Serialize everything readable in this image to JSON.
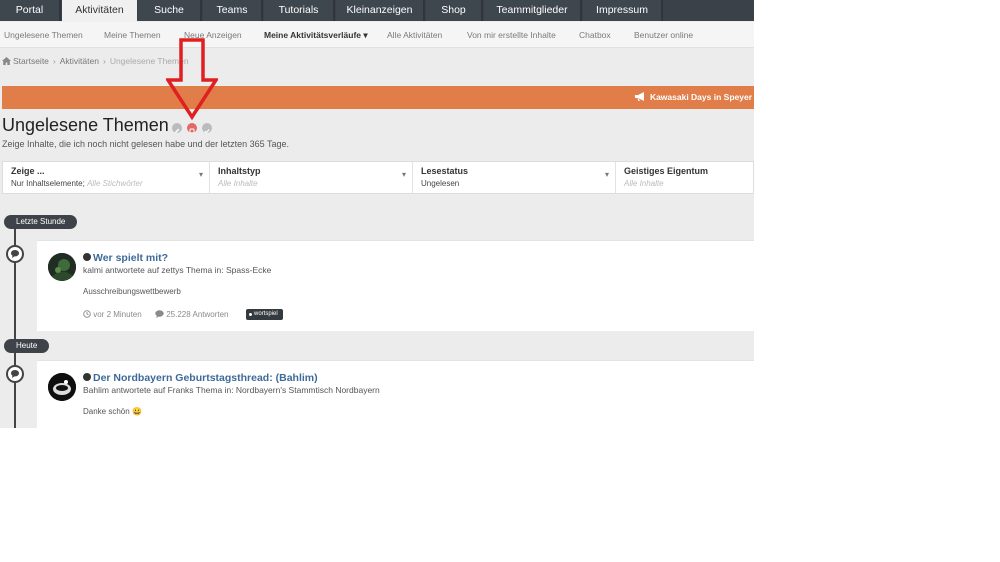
{
  "topnav": {
    "tabs": [
      {
        "label": "Portal"
      },
      {
        "label": "Aktivitäten"
      },
      {
        "label": "Suche"
      },
      {
        "label": "Teams"
      },
      {
        "label": "Tutorials"
      },
      {
        "label": "Kleinanzeigen"
      },
      {
        "label": "Shop"
      },
      {
        "label": "Teammitglieder"
      },
      {
        "label": "Impressum"
      }
    ],
    "active_tab": "Aktivitäten"
  },
  "subnav": {
    "items": [
      {
        "label": "Ungelesene Themen"
      },
      {
        "label": "Meine Themen"
      },
      {
        "label": "Neue Anzeigen"
      },
      {
        "label": "Meine Aktivitätsverläufe ▾"
      },
      {
        "label": "Alle Aktivitäten"
      },
      {
        "label": "Von mir erstellte Inhalte"
      },
      {
        "label": "Chatbox"
      },
      {
        "label": "Benutzer online"
      }
    ]
  },
  "breadcrumb": {
    "items": [
      {
        "label": "Startseite"
      },
      {
        "label": "Aktivitäten"
      },
      {
        "label": "Ungelesene Themen"
      }
    ]
  },
  "banner": {
    "text": "Kawasaki Days in Speyer",
    "color": "#e07d49"
  },
  "page": {
    "title": "Ungelesene Themen",
    "subtitle": "Zeige Inhalte, die ich noch nicht gelesen habe und der letzten 365 Tage."
  },
  "filters": [
    {
      "label": "Zeige ...",
      "value": "Nur Inhaltselemente;",
      "placeholder": "Alle Stichwörter"
    },
    {
      "label": "Inhaltstyp",
      "value": "",
      "placeholder": "Alle Inhalte"
    },
    {
      "label": "Lesestatus",
      "value": "Ungelesen",
      "placeholder": ""
    },
    {
      "label": "Geistiges Eigentum",
      "value": "",
      "placeholder": "Alle Inhalte"
    }
  ],
  "timeline": {
    "groups": [
      {
        "label": "Letzte Stunde",
        "item": {
          "title": "Wer spielt mit?",
          "meta": "kalmi antwortete auf zettys Thema in: Spass-Ecke",
          "excerpt": "Ausschreibungswettbewerb",
          "time": "vor 2 Minuten",
          "replies": "25.228 Antworten",
          "tag": "wortspiel"
        }
      },
      {
        "label": "Heute",
        "item": {
          "title": "Der Nordbayern Geburtstagsthread: (Bahlim)",
          "meta": "Bahlim antwortete auf Franks Thema in: Nordbayern's Stammtisch Nordbayern",
          "excerpt": "Danke schön",
          "emoji": "😀"
        }
      }
    ]
  },
  "colors": {
    "nav_bg": "#3a4148",
    "link": "#3d6a99",
    "annotation_arrow": "#e02020"
  }
}
